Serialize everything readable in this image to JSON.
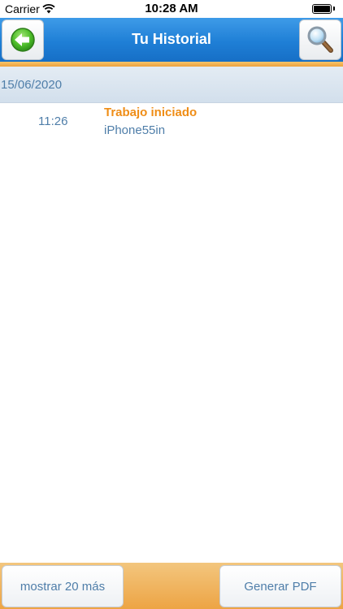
{
  "status_bar": {
    "carrier": "Carrier",
    "time": "10:28 AM"
  },
  "nav": {
    "title": "Tu Historial",
    "back_icon": "back-arrow-icon",
    "search_icon": "magnifier-icon"
  },
  "history": {
    "section_date": "15/06/2020",
    "entries": [
      {
        "time": "11:26",
        "title": "Trabajo iniciado",
        "subtitle": "iPhone55in"
      }
    ]
  },
  "toolbar": {
    "more_label": "mostrar 20 más",
    "pdf_label": "Generar PDF"
  },
  "colors": {
    "nav_blue": "#1f7fd6",
    "accent_orange": "#ef8d16",
    "text_blue": "#4f7ea9"
  }
}
